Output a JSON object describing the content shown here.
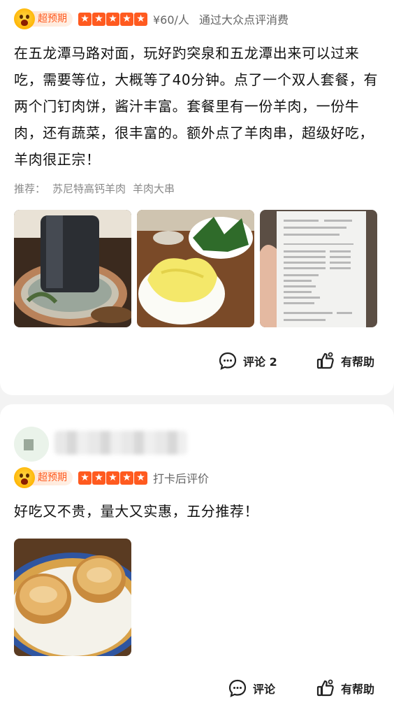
{
  "review1": {
    "badge": "超预期",
    "stars": 5,
    "price": "¥60/人",
    "source": "通过大众点评消费",
    "body": "在五龙潭马路对面，玩好趵突泉和五龙潭出来可以过来吃，需要等位，大概等了40分钟。点了一个双人套餐，有两个门钉肉饼，酱汁丰富。套餐里有一份羊肉，一份牛肉，还有蔬菜，很丰富的。额外点了羊肉串，超级好吃，羊肉很正宗！",
    "recommend_label": "推荐：",
    "recommend_items": [
      "苏尼特高钙羊肉",
      "羊肉大串"
    ],
    "photos": [
      "copper-hotpot-photo",
      "cabbage-greens-photo",
      "receipt-photo"
    ],
    "comment_label": "评论 2",
    "helpful_label": "有帮助"
  },
  "review2": {
    "badge": "超预期",
    "stars": 5,
    "tag": "打卡后评价",
    "body": "好吃又不贵，量大又实惠，五分推荐！",
    "photos": [
      "meat-pies-photo"
    ],
    "comment_label": "评论",
    "helpful_label": "有帮助"
  },
  "colors": {
    "accent": "#ff5a1f",
    "badge_bg": "#ffe6d6",
    "muted": "#888888"
  },
  "icons": [
    "smiley-emoji-icon",
    "star-icon",
    "comment-icon",
    "helpful-thumb-icon"
  ]
}
